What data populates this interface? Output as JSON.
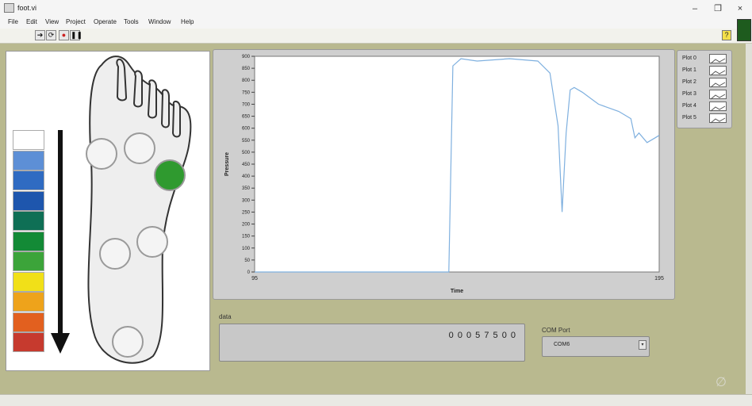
{
  "window": {
    "title": "foot.vi",
    "minimize": "–",
    "maximize": "❐",
    "close": "×"
  },
  "menu": [
    "File",
    "Edit",
    "View",
    "Project",
    "Operate",
    "Tools",
    "Window",
    "Help"
  ],
  "toolbar": {
    "help": "?"
  },
  "colors": {
    "panel": "#b9b98f",
    "plot": "#7fb0df",
    "active_sensor": "#2f9a2f",
    "scale": [
      "#ffffff",
      "#5d8fd6",
      "#2f6bc2",
      "#1e56ad",
      "#0f6f55",
      "#138a36",
      "#3ca43a",
      "#f1e018",
      "#eea31b",
      "#e2601f",
      "#c63a2e"
    ]
  },
  "sensors": [
    {
      "name": "toe-left",
      "active": false
    },
    {
      "name": "toe-mid",
      "active": false
    },
    {
      "name": "ball-right",
      "active": true
    },
    {
      "name": "arch-left",
      "active": false
    },
    {
      "name": "arch-right",
      "active": false
    },
    {
      "name": "heel",
      "active": false
    }
  ],
  "chart_data": {
    "type": "line",
    "xlabel": "Time",
    "ylabel": "Pressure",
    "xlim": [
      95,
      195
    ],
    "ylim": [
      0,
      900
    ],
    "x_ticks": [
      "95",
      "195"
    ],
    "y_ticks": [
      "0",
      "50",
      "100",
      "150",
      "200",
      "250",
      "300",
      "350",
      "400",
      "450",
      "500",
      "550",
      "600",
      "650",
      "700",
      "750",
      "800",
      "850",
      "900"
    ],
    "series": [
      {
        "name": "Plot 0",
        "x": [
          95,
          143,
          144,
          146,
          150,
          158,
          165,
          168,
          170,
          171,
          172,
          173,
          174,
          176,
          180,
          185,
          188,
          189,
          190,
          192,
          194,
          195
        ],
        "y": [
          0,
          0,
          860,
          890,
          880,
          890,
          880,
          830,
          610,
          250,
          580,
          760,
          770,
          750,
          700,
          670,
          640,
          560,
          580,
          540,
          560,
          570
        ]
      }
    ],
    "legend": [
      "Plot 0",
      "Plot 1",
      "Plot 2",
      "Plot 3",
      "Plot 4",
      "Plot 5"
    ]
  },
  "data_field": {
    "label": "data",
    "value": "0 0 0 5 7 5 0 0"
  },
  "com_port": {
    "label": "COM Port",
    "value": "COM6"
  }
}
